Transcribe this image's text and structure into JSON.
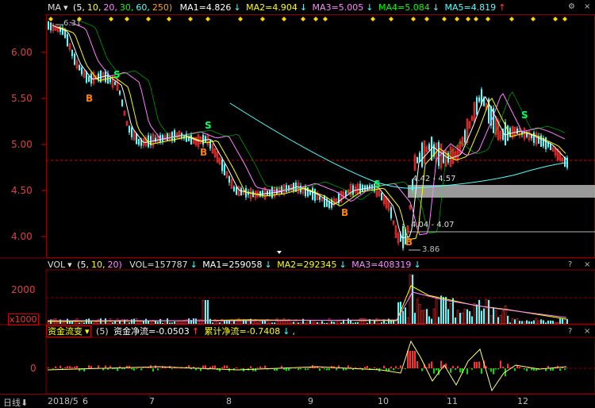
{
  "price_legend": {
    "indicator": "MA",
    "params": "(5,10,20,30,60,250)",
    "ma1": "MA1=4.826",
    "ma2": "MA2=4.904",
    "ma3": "MA3=5.005",
    "ma4": "MA4=5.084",
    "ma5": "MA5=4.819"
  },
  "vol_legend": {
    "indicator": "VOL",
    "params": "(5,10,20)",
    "vol": "VOL=157787",
    "ma1": "MA1=259058",
    "ma2": "MA2=292345",
    "ma3": "MA3=408319"
  },
  "flow_legend": {
    "indicator": "资金流变",
    "params": "(5)",
    "net": "资金净流=-0.0503",
    "cum": "累计净流=-0.7408"
  },
  "controls": {
    "close": "×",
    "help": "?",
    "settings": "⚙"
  },
  "price_axis": [
    "6.00",
    "5.50",
    "5.00",
    "4.50",
    "4.00"
  ],
  "vol_axis": {
    "tick": "2000",
    "unit": "x1000"
  },
  "flow_axis": {
    "tick": "0"
  },
  "annotations": {
    "high_label": "6.31",
    "low_label": "3.86",
    "zone_upper": "4.42 - 4.57",
    "zone_lower": "4.04 - 4.07",
    "buy": "B",
    "sell": "S"
  },
  "x_axis": {
    "period": "日线",
    "labels": [
      "2018/5",
      "6",
      "7",
      "8",
      "9",
      "10",
      "11",
      "12"
    ]
  },
  "colors": {
    "up": "#ff3232",
    "down": "#54ffff",
    "ma5": "#ffffff",
    "ma10": "#ffff00",
    "ma20": "#ff80ff",
    "ma30": "#00ff00",
    "ma60": "#54ffff",
    "ma250": "#ffa500",
    "grid": "#800000",
    "zone": "#b4b4b4"
  }
}
